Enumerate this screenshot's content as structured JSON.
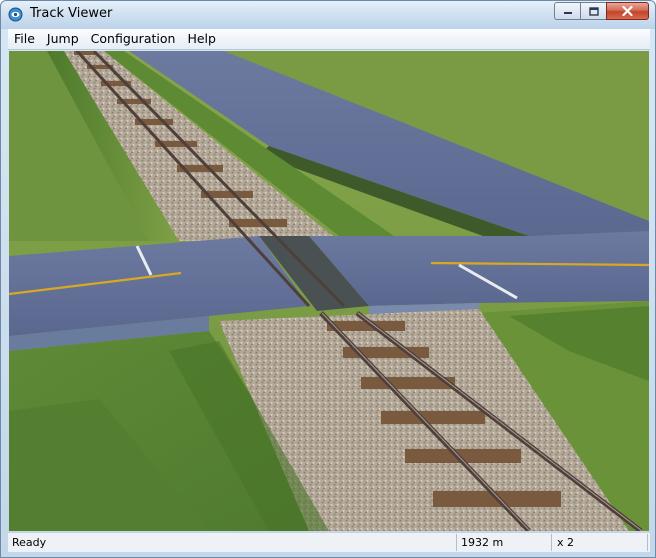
{
  "window": {
    "title": "Track Viewer"
  },
  "menu": {
    "items": [
      "File",
      "Jump",
      "Configuration",
      "Help"
    ]
  },
  "viewport": {
    "description_icon": "3d-track-scene"
  },
  "status": {
    "state": "Ready",
    "distance": "1932 m",
    "speed": "x 2"
  },
  "colors": {
    "grass": "#6f9440",
    "road": "#5f6e96",
    "ballast": "#b9ae9e",
    "sleeper": "#7a5a3e",
    "rail": "#5b4a44",
    "road_line": "#e0b020"
  }
}
